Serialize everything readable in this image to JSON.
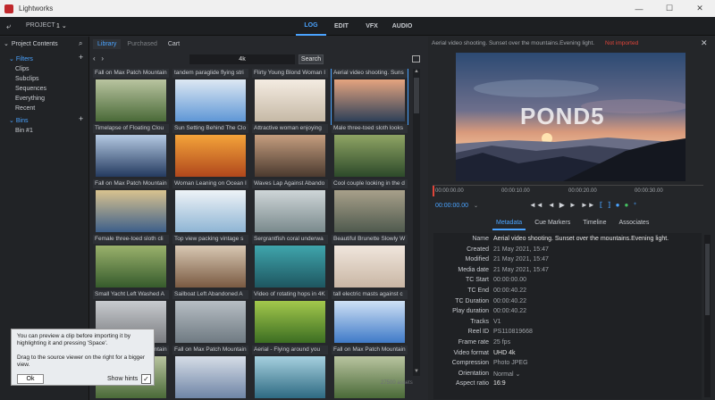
{
  "titlebar": {
    "title": "Lightworks",
    "minimize": "—",
    "maximize": "☐",
    "close": "✕"
  },
  "nav": {
    "back_icon": "⤶",
    "project_label": "PROJECT",
    "project_number": "1 ⌄",
    "tabs": [
      "LOG",
      "EDIT",
      "VFX",
      "AUDIO"
    ],
    "active_tab": "LOG"
  },
  "sidebar": {
    "header": "Project Contents",
    "search_icon": "⌕",
    "filters_label": "Filters",
    "items": [
      "Clips",
      "Subclips",
      "Sequences",
      "Everything",
      "Recent"
    ],
    "bins_label": "Bins",
    "bin_items": [
      "Bin #1"
    ]
  },
  "browser": {
    "tabs": [
      "Library",
      "Purchased",
      "Cart"
    ],
    "search_value": "4k",
    "search_button": "Search",
    "asset_count": "27500 assets",
    "clips": [
      {
        "label": "Fall on Max Patch Mountain"
      },
      {
        "label": "tandem paraglide flying stri"
      },
      {
        "label": "Flirty Young Blond Woman I"
      },
      {
        "label": "Aerial video shooting. Suns"
      },
      {
        "label": "Timelapse of Floating Clou"
      },
      {
        "label": "Sun Setting Behind The Clo"
      },
      {
        "label": "Attractive woman enjoying"
      },
      {
        "label": "Male three-toed sloth looks"
      },
      {
        "label": "Fall on Max Patch Mountain"
      },
      {
        "label": "Woman Leaning on Ocean I"
      },
      {
        "label": "Waves Lap Against Abando"
      },
      {
        "label": "Cool couple looking in the d"
      },
      {
        "label": "Female three-toed sloth cli"
      },
      {
        "label": "Top view packing vintage s"
      },
      {
        "label": "Sergrantfish coral underwa"
      },
      {
        "label": "Beautiful Brunette Slowly W"
      },
      {
        "label": "Small Yacht Left Washed A"
      },
      {
        "label": "Sailboat Left Abandoned A"
      },
      {
        "label": "Video of rotating hops in 4K"
      },
      {
        "label": "tall electric masts against c"
      },
      {
        "label": "Fall on Max Patch Mountain"
      },
      {
        "label": "Fall on Max Patch Mountain"
      },
      {
        "label": "Aerial - Flying around you"
      },
      {
        "label": "Fall on Max Patch Mountain"
      }
    ]
  },
  "tooltip": {
    "line1": "You can preview a clip before importing it by highlighting it and pressing 'Space'.",
    "line2": "Drag to the source viewer on the right for a bigger view.",
    "ok": "Ok",
    "show_hints": "Show hints",
    "check": "✓"
  },
  "viewer": {
    "header": "Aerial video shooting. Sunset over the mountains.Evening light.",
    "not_imported": "Not imported",
    "close_icon": "✕",
    "watermark": "POND5",
    "timecode": "00:00:00.00",
    "tc_dropdown": "⌄",
    "ruler": [
      "00:00:00.00",
      "00:00:10.00",
      "00:00:20.00",
      "00:00:30.00"
    ],
    "controls": [
      "◄◄",
      "◄",
      "▶",
      "►",
      "►►"
    ],
    "meta_tabs": [
      "Metadata",
      "Cue Markers",
      "Timeline",
      "Associates"
    ],
    "metadata": [
      {
        "k": "Name",
        "v": "Aerial video shooting. Sunset over the mountains.Evening light."
      },
      {
        "k": "Created",
        "v": "21 May 2021, 15:47"
      },
      {
        "k": "Modified",
        "v": "21 May 2021, 15:47"
      },
      {
        "k": "Media date",
        "v": "21 May 2021, 15:47"
      },
      {
        "k": "TC Start",
        "v": "00:00:00.00"
      },
      {
        "k": "TC End",
        "v": "00:00:40.22"
      },
      {
        "k": "TC Duration",
        "v": "00:00:40.22"
      },
      {
        "k": "Play duration",
        "v": "00:00:40.22"
      },
      {
        "k": "Tracks",
        "v": "V1"
      },
      {
        "k": "Reel ID",
        "v": "PS110819668"
      },
      {
        "k": "Frame rate",
        "v": "25 fps"
      },
      {
        "k": "Video format",
        "v": "UHD 4k"
      },
      {
        "k": "Compression",
        "v": "Photo JPEG"
      },
      {
        "k": "Orientation",
        "v": "Normal ⌄"
      },
      {
        "k": "Aspect ratio",
        "v": "16:9"
      }
    ]
  }
}
